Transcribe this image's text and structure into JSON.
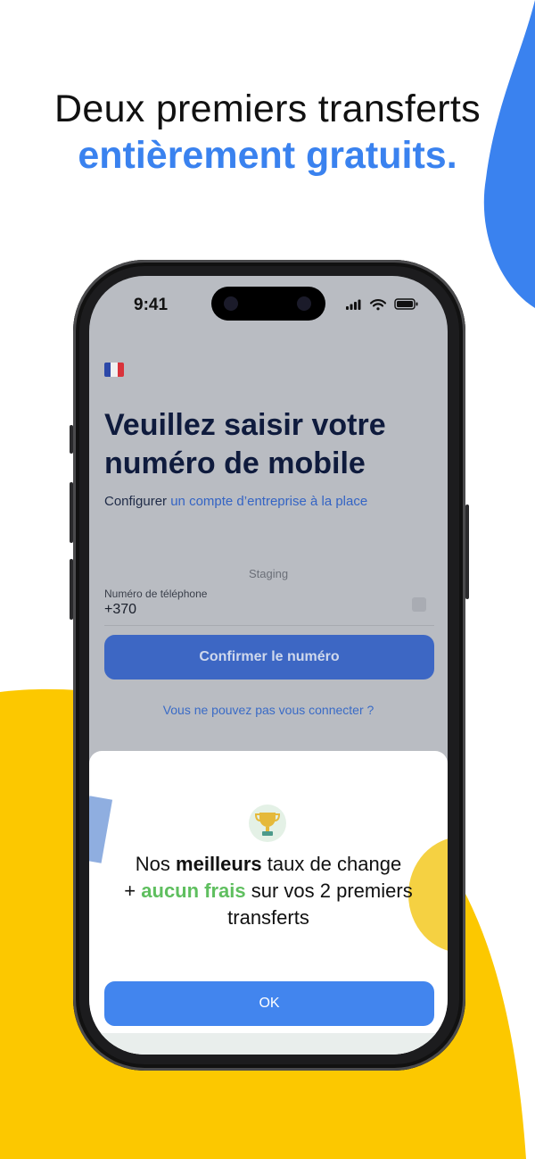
{
  "headline": {
    "line1": "Deux premiers transferts",
    "line2": "entièrement gratuits."
  },
  "status_bar": {
    "time": "9:41",
    "icons": [
      "signal-icon",
      "wifi-icon",
      "battery-icon"
    ]
  },
  "login": {
    "flag": "france-flag",
    "title": "Veuillez saisir votre numéro de mobile",
    "subtitle_prefix": "Configurer",
    "subtitle_link": "un compte d’entreprise à la place",
    "environment_label": "Staging",
    "phone_field_label": "Numéro de téléphone",
    "phone_field_value": "+370",
    "confirm_button": "Confirmer le numéro",
    "cant_connect_link": "Vous ne pouvez pas vous connecter ?"
  },
  "promo_sheet": {
    "icon": "trophy-icon",
    "text_part1": "Nos ",
    "text_bold": "meilleurs",
    "text_part2": " taux de change",
    "text_plus": "+ ",
    "text_green": "aucun frais",
    "text_part3": " sur vos 2 premiers transferts",
    "ok_button": "OK"
  },
  "colors": {
    "accent_blue": "#3a82ef",
    "brand_yellow": "#fcc800",
    "promo_green": "#5fbf5f",
    "dark_navy": "#0f1b3d"
  }
}
